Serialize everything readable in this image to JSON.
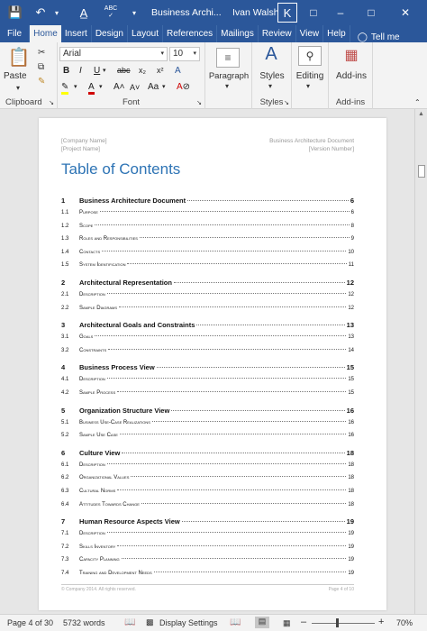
{
  "titlebar": {
    "doc_title": "Business Archi...",
    "user_name": "Ivan Walsh",
    "user_initial": "K"
  },
  "tabs": [
    "File",
    "Home",
    "Insert",
    "Design",
    "Layout",
    "References",
    "Mailings",
    "Review",
    "View",
    "Help"
  ],
  "tell_me": "Tell me",
  "ribbon": {
    "clipboard": {
      "paste_label": "Paste",
      "group_label": "Clipboard"
    },
    "font": {
      "font_name": "Arial",
      "font_size": "10",
      "group_label": "Font"
    },
    "paragraph": {
      "label": "Paragraph"
    },
    "styles": {
      "label": "Styles",
      "group_label": "Styles"
    },
    "editing": {
      "label": "Editing"
    },
    "addins": {
      "label": "Add-ins",
      "group_label": "Add-ins"
    }
  },
  "page": {
    "header_left_1": "[Company Name]",
    "header_left_2": "[Project Name]",
    "header_right_1": "Business Architecture Document",
    "header_right_2": "[Version Number]",
    "toc_title": "Table of Contents",
    "toc": [
      {
        "num": "1",
        "text": "Business Architecture Document",
        "page": "6",
        "level": 1
      },
      {
        "num": "1.1",
        "text": "Purpose",
        "page": "6",
        "level": 2
      },
      {
        "num": "1.2",
        "text": "Scope",
        "page": "8",
        "level": 2
      },
      {
        "num": "1.3",
        "text": "Roles and Responsibilities",
        "page": "9",
        "level": 2
      },
      {
        "num": "1.4",
        "text": "Contacts",
        "page": "10",
        "level": 2
      },
      {
        "num": "1.5",
        "text": "System Identification",
        "page": "11",
        "level": 2
      },
      {
        "num": "2",
        "text": "Architectural Representation",
        "page": "12",
        "level": 1
      },
      {
        "num": "2.1",
        "text": "Description",
        "page": "12",
        "level": 2
      },
      {
        "num": "2.2",
        "text": "Sample Diagrams",
        "page": "12",
        "level": 2
      },
      {
        "num": "3",
        "text": "Architectural Goals and Constraints",
        "page": "13",
        "level": 1
      },
      {
        "num": "3.1",
        "text": "Goals",
        "page": "13",
        "level": 2
      },
      {
        "num": "3.2",
        "text": "Constraints",
        "page": "14",
        "level": 2
      },
      {
        "num": "4",
        "text": "Business Process View",
        "page": "15",
        "level": 1
      },
      {
        "num": "4.1",
        "text": "Description",
        "page": "15",
        "level": 2
      },
      {
        "num": "4.2",
        "text": "Sample Process",
        "page": "15",
        "level": 2
      },
      {
        "num": "5",
        "text": "Organization Structure View",
        "page": "16",
        "level": 1
      },
      {
        "num": "5.1",
        "text": "Business Use-Case Realizations",
        "page": "16",
        "level": 2
      },
      {
        "num": "5.2",
        "text": "Sample Use Case",
        "page": "16",
        "level": 2
      },
      {
        "num": "6",
        "text": "Culture View",
        "page": "18",
        "level": 1
      },
      {
        "num": "6.1",
        "text": "Description",
        "page": "18",
        "level": 2
      },
      {
        "num": "6.2",
        "text": "Organizational Values",
        "page": "18",
        "level": 2
      },
      {
        "num": "6.3",
        "text": "Cultural Norms",
        "page": "18",
        "level": 2
      },
      {
        "num": "6.4",
        "text": "Attitudes Towards Change",
        "page": "18",
        "level": 2
      },
      {
        "num": "7",
        "text": "Human Resource Aspects View",
        "page": "19",
        "level": 1
      },
      {
        "num": "7.1",
        "text": "Description",
        "page": "19",
        "level": 2
      },
      {
        "num": "7.2",
        "text": "Skills Inventory",
        "page": "19",
        "level": 2
      },
      {
        "num": "7.3",
        "text": "Capacity Planning",
        "page": "19",
        "level": 2
      },
      {
        "num": "7.4",
        "text": "Training and Development Needs",
        "page": "19",
        "level": 2
      }
    ],
    "footer_left": "© Company 2014. All rights reserved.",
    "footer_right": "Page 4 of 10"
  },
  "status": {
    "page": "Page 4 of 30",
    "words": "5732 words",
    "display": "Display Settings",
    "zoom": "70%"
  }
}
